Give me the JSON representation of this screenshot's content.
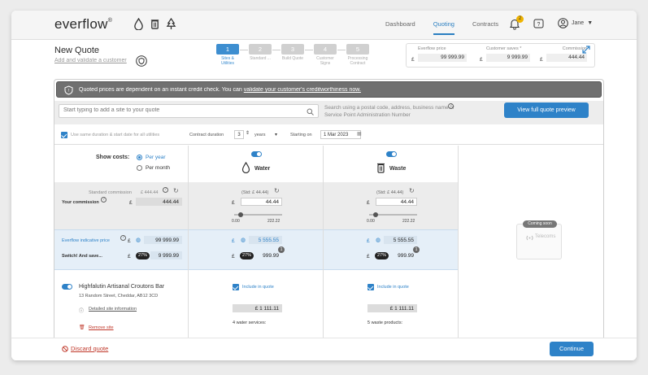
{
  "brand": {
    "name": "everflow",
    "mark": "®"
  },
  "nav": {
    "dashboard": "Dashboard",
    "quoting": "Quoting",
    "contracts": "Contracts",
    "notifications": "2",
    "user": "Jane"
  },
  "header": {
    "title": "New Quote",
    "subtitle": "Add and validate a customer"
  },
  "steps": [
    {
      "num": "1",
      "label": "Sites & Utilities"
    },
    {
      "num": "2",
      "label": "Standard ..."
    },
    {
      "num": "3",
      "label": "Build Quote"
    },
    {
      "num": "4",
      "label": "Customer Signs"
    },
    {
      "num": "5",
      "label": "Processing Contract"
    }
  ],
  "summary": {
    "everflow_price_label": "Everflow price",
    "everflow_price": "99 999.99",
    "customer_saves_label": "Customer saves *",
    "customer_saves": "9 999.99",
    "commission_label": "Commission",
    "commission": "444.44",
    "currency": "£"
  },
  "notice": {
    "text": "Quoted prices are dependent on an instant credit check. You can",
    "link": "validate your customer's creditworthiness now."
  },
  "search": {
    "placeholder": "Start typing to add a site to your quote",
    "hint": "Search using a postal code, address, business name or Service Point Administration Number",
    "preview_button": "View full quote preview"
  },
  "options": {
    "same_duration": "Use same duration & start date for all utilities",
    "duration_label": "Contract duration",
    "duration_value": "3",
    "duration_unit": "years",
    "start_label": "Starting on",
    "start_value": "1 Mar 2023"
  },
  "costs": {
    "show_label": "Show costs:",
    "per_year": "Per year",
    "per_month": "Per month",
    "std_commission_label": "Standard commission",
    "std_commission": "£ 444.44",
    "your_commission_label": "Your commission",
    "your_commission": "444.44",
    "indicative_label": "Everflow indicative price",
    "indicative": "99 999.99",
    "switch_label": "Switch! And save...",
    "switch_pct": "27%",
    "switch_value": "9 999.99",
    "currency": "£"
  },
  "utilities": [
    {
      "name": "Water",
      "std": "(Std: £ 44.44)",
      "value": "44.44",
      "min": "0.00",
      "max": "222.22",
      "price": "5 555.55",
      "pct": "27%",
      "save": "999.99",
      "info": "1",
      "include": "Include in quote",
      "amount": "£ 1 111.11",
      "services": "4 water services:"
    },
    {
      "name": "Waste",
      "std": "(Std: £ 44.44)",
      "value": "44.44",
      "min": "0.00",
      "max": "222.22",
      "price": "5 555.55",
      "pct": "27%",
      "save": "999.99",
      "info": "1",
      "include": "Include in quote",
      "amount": "£ 1 111.11",
      "services": "5 waste products:"
    }
  ],
  "telecoms": {
    "tag": "Coming soon",
    "name": "Telecoms"
  },
  "site": {
    "name": "Highfalutin Artisanal Croutons Bar",
    "address": "13 Random Street, Cheddar, AB12 3CD",
    "details_link": "Detailed site information",
    "remove_link": "Remove site"
  },
  "footer": {
    "discard": "Discard quote",
    "continue": "Continue"
  }
}
